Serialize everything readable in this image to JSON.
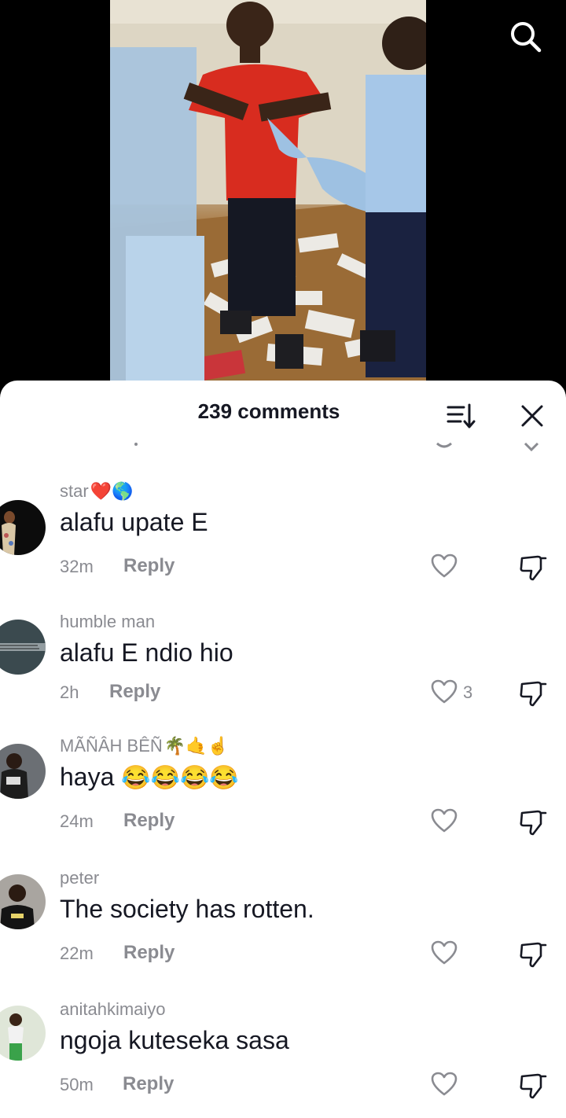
{
  "sheet": {
    "title": "239 comments"
  },
  "icons": {
    "search": "search-icon",
    "sort": "sort-icon",
    "close": "close-icon",
    "like": "heart-icon",
    "dislike": "thumbs-down-icon"
  },
  "comments": [
    {
      "username": "star",
      "username_emoji": "❤️🌎",
      "text": "alafu upate E",
      "time": "32m",
      "reply": "Reply",
      "likes": ""
    },
    {
      "username": "humble man",
      "username_emoji": "",
      "text": "alafu E ndio hio",
      "time": "2h",
      "reply": "Reply",
      "likes": "3"
    },
    {
      "username": "MÃÑÂH BÊÑ",
      "username_emoji": "🌴🤙☝",
      "text": "haya",
      "text_emoji": "😂😂😂😂",
      "time": "24m",
      "reply": "Reply",
      "likes": ""
    },
    {
      "username": "peter",
      "username_emoji": "",
      "text": "The society has rotten.",
      "time": "22m",
      "reply": "Reply",
      "likes": ""
    },
    {
      "username": "anitahkimaiyo",
      "username_emoji": "",
      "text": "ngoja kuteseka sasa",
      "time": "50m",
      "reply": "Reply",
      "likes": ""
    }
  ]
}
